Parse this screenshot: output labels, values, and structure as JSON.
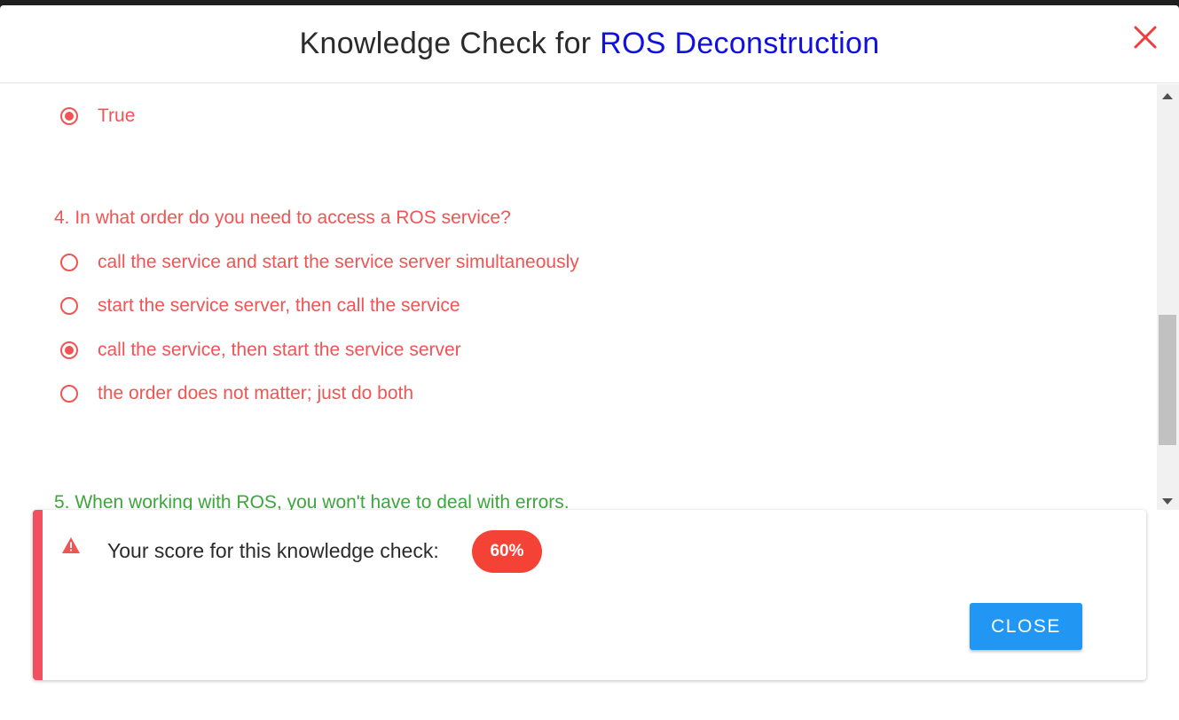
{
  "modal": {
    "title_prefix": "Knowledge Check for ",
    "title_course": "ROS Deconstruction",
    "close_icon": "close-x-icon"
  },
  "quiz": {
    "prev_answer": {
      "label": "True",
      "selected": true
    },
    "question4": {
      "text": "4. In what order do you need to access a ROS service?",
      "status": "incorrect",
      "options": [
        {
          "label": "call the service and start the service server simultaneously",
          "selected": false
        },
        {
          "label": "start the service server, then call the service",
          "selected": false
        },
        {
          "label": "call the service, then start the service server",
          "selected": true
        },
        {
          "label": "the order does not matter; just do both",
          "selected": false
        }
      ]
    },
    "question5": {
      "text": "5. When working with ROS, you won't have to deal with errors.",
      "status": "correct"
    }
  },
  "result": {
    "icon": "warning-icon",
    "label": "Your score for this knowledge check:",
    "score": "60%",
    "close_button": "CLOSE"
  },
  "colors": {
    "wrong": "#f05454",
    "right": "#3ca63c",
    "accent": "#1010e0",
    "badge": "#f44336",
    "button": "#2196f3"
  }
}
